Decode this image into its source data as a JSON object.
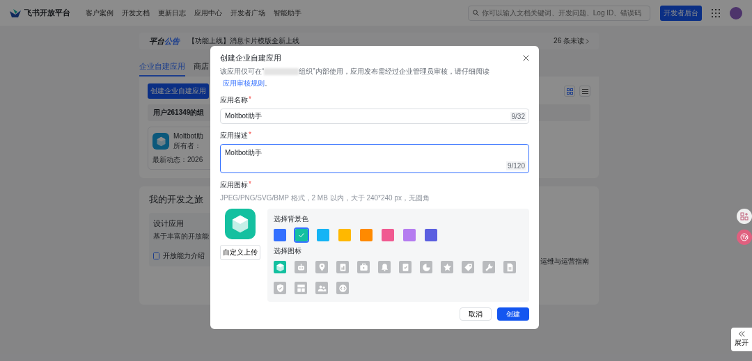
{
  "nav": {
    "brand": "飞书开放平台",
    "menu": [
      "客户案例",
      "开发文档",
      "更新日志",
      "应用中心",
      "开发者广场",
      "智能助手"
    ],
    "search": {
      "placeholder": "你可以输入文档关键词、开发问题、Log ID、错误码"
    },
    "console_button": "开发者后台"
  },
  "announcement": {
    "label_a": "平台",
    "label_b": "公告",
    "text": "【功能上线】消息卡片模版全新上线",
    "unread": "26 条未读"
  },
  "apps_panel": {
    "tabs": [
      {
        "label": "企业自建应用",
        "selected": true
      },
      {
        "label": "商店",
        "selected": false
      }
    ],
    "create_button": "创建企业自建应用",
    "view_modes": [
      {
        "kind": "grid",
        "selected": true
      },
      {
        "kind": "list",
        "selected": false
      }
    ],
    "org_banner": "用户261349的组",
    "app": {
      "name": "Moltbot助",
      "owner_label": "所有者：",
      "activity": "最新动态：2026"
    }
  },
  "journey": {
    "title": "我的开发之旅",
    "step": {
      "title": "设计应用",
      "description": "基于丰富的开放能",
      "link": "开放能力介绍"
    },
    "guide_link": "运维与运营指南"
  },
  "side": {
    "expand_label": "展开"
  },
  "dialog": {
    "title": "创建企业自建应用",
    "notice_before": "该应用仅可在“",
    "notice_after": "组织”内部使用，应用发布需经过企业管理员审核，请仔细阅读",
    "rules_link": "应用审核规则",
    "notice_end": "。",
    "fields": [
      {
        "label": "应用名称",
        "required_mark": "*",
        "kind": "input",
        "value": "Moltbot助手",
        "counter": "9/32",
        "focused": false
      },
      {
        "label": "应用描述",
        "required_mark": "*",
        "kind": "textarea",
        "value": "Moltbot助手",
        "counter": "9/120",
        "focused": true
      }
    ],
    "icon_section": {
      "label": "应用图标",
      "required_mark": "*",
      "hint": "JPEG/PNG/SVG/BMP 格式，2 MB 以内，大于 240*240 px，无圆角",
      "upload_button": "自定义上传",
      "colors_label": "选择背景色",
      "colors": [
        {
          "color": "#3370ff",
          "selected": false
        },
        {
          "color": "#14c0a0",
          "selected": true
        },
        {
          "color": "#14b4f5",
          "selected": false
        },
        {
          "color": "#ffb800",
          "selected": false
        },
        {
          "color": "#ff8a00",
          "selected": false
        },
        {
          "color": "#f05a91",
          "selected": false
        },
        {
          "color": "#b57cf0",
          "selected": false
        },
        {
          "color": "#5b5fe0",
          "selected": false
        }
      ],
      "icons_label": "选择图标",
      "icons": [
        {
          "kind": "cube",
          "selected": true
        },
        {
          "kind": "robot",
          "selected": false
        },
        {
          "kind": "pin",
          "selected": false
        },
        {
          "kind": "report",
          "selected": false
        },
        {
          "kind": "briefcase",
          "selected": false
        },
        {
          "kind": "bell",
          "selected": false
        },
        {
          "kind": "checklist",
          "selected": false
        },
        {
          "kind": "pie",
          "selected": false
        },
        {
          "kind": "star",
          "selected": false
        },
        {
          "kind": "tag",
          "selected": false
        },
        {
          "kind": "wrench",
          "selected": false
        },
        {
          "kind": "document",
          "selected": false
        },
        {
          "kind": "shield",
          "selected": false
        },
        {
          "kind": "layout",
          "selected": false
        },
        {
          "kind": "people",
          "selected": false
        },
        {
          "kind": "code",
          "selected": false
        }
      ]
    },
    "cancel_button": "取消",
    "submit_button": "创建"
  }
}
